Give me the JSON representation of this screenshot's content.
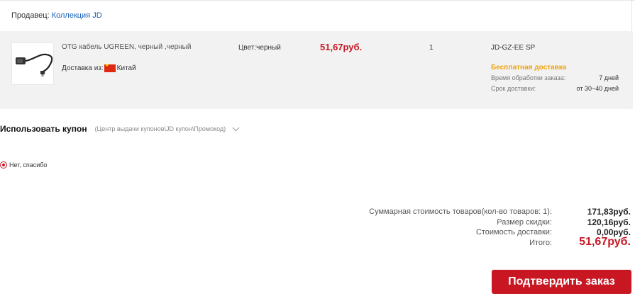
{
  "seller": {
    "label": "Продавец:",
    "name": "Коллекция JD"
  },
  "item": {
    "name": "OTG кабель UGREEN, черный ,черный",
    "ship_from_label": "Доставка из:",
    "ship_from_country": "Китай",
    "color": "Цвет:черный",
    "price": "51,67руб.",
    "quantity": "1",
    "code": "JD-GZ-EE SP",
    "free_shipping": "Бесплатная доставка",
    "processing_label": "Время обработки заказа:",
    "processing_value": "7 дней",
    "delivery_label": "Срок доставки:",
    "delivery_value": "от 30~40 дней"
  },
  "coupon": {
    "title": "Использовать купон",
    "hint": "(Центр выдачи купонов\\JD купон\\Промокод)",
    "option": "Нет, спасибо"
  },
  "summary": {
    "subtotal_label": "Суммарная стоимость товаров(кол-во товаров: 1):",
    "subtotal_value": "171,83руб.",
    "discount_label": "Размер скидки:",
    "discount_value": "120,16руб.",
    "shipping_label": "Стоимость доставки:",
    "shipping_value": "0,00руб.",
    "total_label": "Итого:",
    "total_value": "51,67руб."
  },
  "actions": {
    "confirm_label": "Подтвердить заказ"
  },
  "colors": {
    "accent": "#c81623",
    "free_shipping": "#f0a30a",
    "link": "#1a5fb4"
  }
}
